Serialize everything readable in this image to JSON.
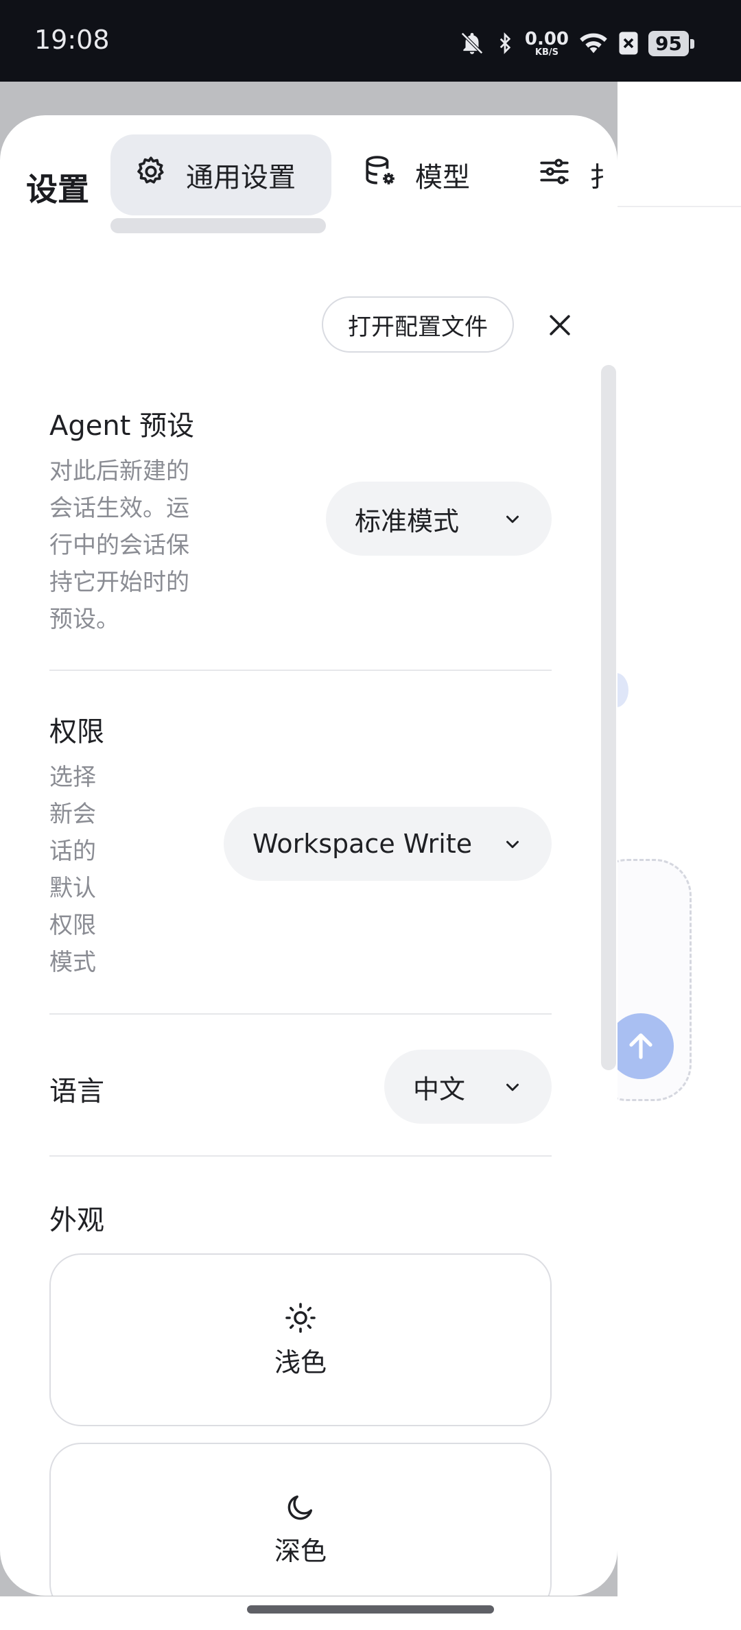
{
  "status_bar": {
    "time": "19:08",
    "net_speed_value": "0.00",
    "net_speed_unit": "KB/S",
    "battery": "95",
    "icons": [
      "bell-off-icon",
      "bluetooth-icon",
      "wifi-icon",
      "sim-off-icon",
      "battery-icon"
    ]
  },
  "panel": {
    "title": "设置",
    "tabs": [
      {
        "label": "通用设置",
        "icon": "gear-icon",
        "active": true
      },
      {
        "label": "模型",
        "icon": "database-gear-icon",
        "active": false
      },
      {
        "label": "扌",
        "icon": "sliders-icon",
        "active": false
      }
    ],
    "open_config_label": "打开配置文件",
    "close_icon": "close-icon"
  },
  "settings": {
    "agent_preset": {
      "title": "Agent 预设",
      "description_lines": [
        "对此后新建的",
        "会话生效。运",
        "行中的会话保",
        "持它开始时的",
        "预设。"
      ],
      "value": "标准模式"
    },
    "permissions": {
      "title": "权限",
      "description_lines": [
        "选择",
        "新会",
        "话的",
        "默认",
        "权限",
        "模式"
      ],
      "value": "Workspace Write"
    },
    "language": {
      "title": "语言",
      "value": "中文"
    },
    "appearance": {
      "title": "外观",
      "options": [
        {
          "label": "浅色",
          "icon": "sun-icon"
        },
        {
          "label": "深色",
          "icon": "moon-icon"
        }
      ]
    }
  },
  "colors": {
    "accent_send": "#a9bff2",
    "backdrop_dim": "#bdbec1",
    "select_bg": "#f2f3f5",
    "active_tab_bg": "#e9ebf0"
  }
}
